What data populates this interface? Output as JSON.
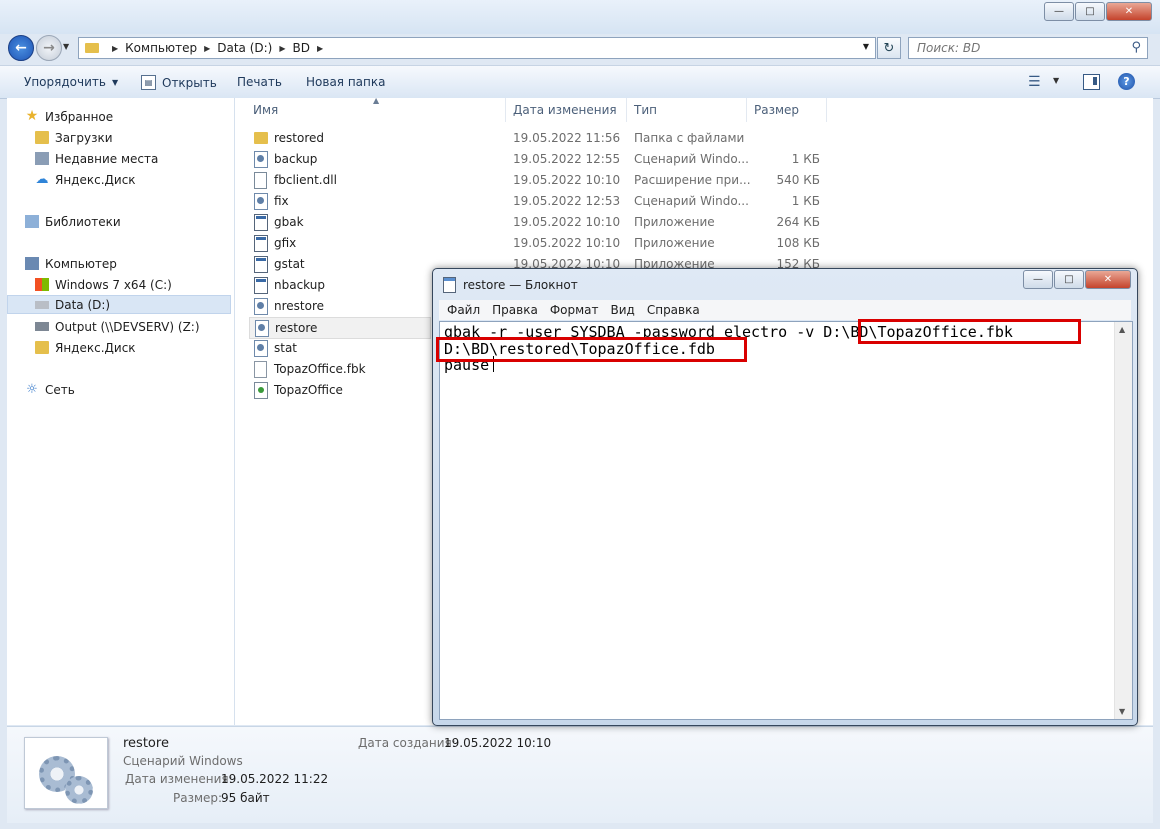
{
  "explorer": {
    "address": {
      "crumbs": [
        "Компьютер",
        "Data (D:)",
        "BD"
      ]
    },
    "search": {
      "placeholder": "Поиск: BD"
    },
    "toolbar": {
      "organize": "Упорядочить",
      "open": "Открыть",
      "print": "Печать",
      "new_folder": "Новая папка"
    },
    "nav": {
      "favorites": "Избранное",
      "downloads": "Загрузки",
      "recent": "Недавние места",
      "yandex1": "Яндекс.Диск",
      "libraries": "Библиотеки",
      "computer": "Компьютер",
      "drive_c": "Windows 7 x64 (C:)",
      "drive_d": "Data (D:)",
      "drive_z": "Output (\\\\DEVSERV) (Z:)",
      "yandex2": "Яндекс.Диск",
      "network": "Сеть"
    },
    "columns": {
      "name": "Имя",
      "date": "Дата изменения",
      "type": "Тип",
      "size": "Размер"
    },
    "files": [
      {
        "name": "restored",
        "date": "19.05.2022 11:56",
        "type": "Папка с файлами",
        "size": "",
        "icon": "folder"
      },
      {
        "name": "backup",
        "date": "19.05.2022 12:55",
        "type": "Сценарий Windo...",
        "size": "1 КБ",
        "icon": "script"
      },
      {
        "name": "fbclient.dll",
        "date": "19.05.2022 10:10",
        "type": "Расширение при...",
        "size": "540 КБ",
        "icon": "dll"
      },
      {
        "name": "fix",
        "date": "19.05.2022 12:53",
        "type": "Сценарий Windo...",
        "size": "1 КБ",
        "icon": "script"
      },
      {
        "name": "gbak",
        "date": "19.05.2022 10:10",
        "type": "Приложение",
        "size": "264 КБ",
        "icon": "app"
      },
      {
        "name": "gfix",
        "date": "19.05.2022 10:10",
        "type": "Приложение",
        "size": "108 КБ",
        "icon": "app"
      },
      {
        "name": "gstat",
        "date": "19.05.2022 10:10",
        "type": "Приложение",
        "size": "152 КБ",
        "icon": "app"
      },
      {
        "name": "nbackup",
        "date": "",
        "type": "",
        "size": "",
        "icon": "app"
      },
      {
        "name": "nrestore",
        "date": "",
        "type": "",
        "size": "",
        "icon": "script"
      },
      {
        "name": "restore",
        "date": "",
        "type": "",
        "size": "",
        "icon": "script"
      },
      {
        "name": "stat",
        "date": "",
        "type": "",
        "size": "",
        "icon": "script"
      },
      {
        "name": "TopazOffice.fbk",
        "date": "",
        "type": "",
        "size": "",
        "icon": "file"
      },
      {
        "name": "TopazOffice",
        "date": "",
        "type": "",
        "size": "",
        "icon": "topaz"
      }
    ],
    "details": {
      "name": "restore",
      "type": "Сценарий Windows",
      "modified_label": "Дата изменения:",
      "modified": "19.05.2022 11:22",
      "size_label": "Размер:",
      "size": "95 байт",
      "created_label": "Дата создания:",
      "created": "19.05.2022 10:10"
    }
  },
  "notepad": {
    "title": "restore — Блокнот",
    "menu": [
      "Файл",
      "Правка",
      "Формат",
      "Вид",
      "Справка"
    ],
    "line1_cmd": "gbak -r -user SYSDBA -password electro -v ",
    "line1_path": "D:\\BD\\TopazOffice.fbk",
    "line2": "D:\\BD\\restored\\TopazOffice.fdb",
    "line3": "pause",
    "highlight_color": "#d90000"
  }
}
